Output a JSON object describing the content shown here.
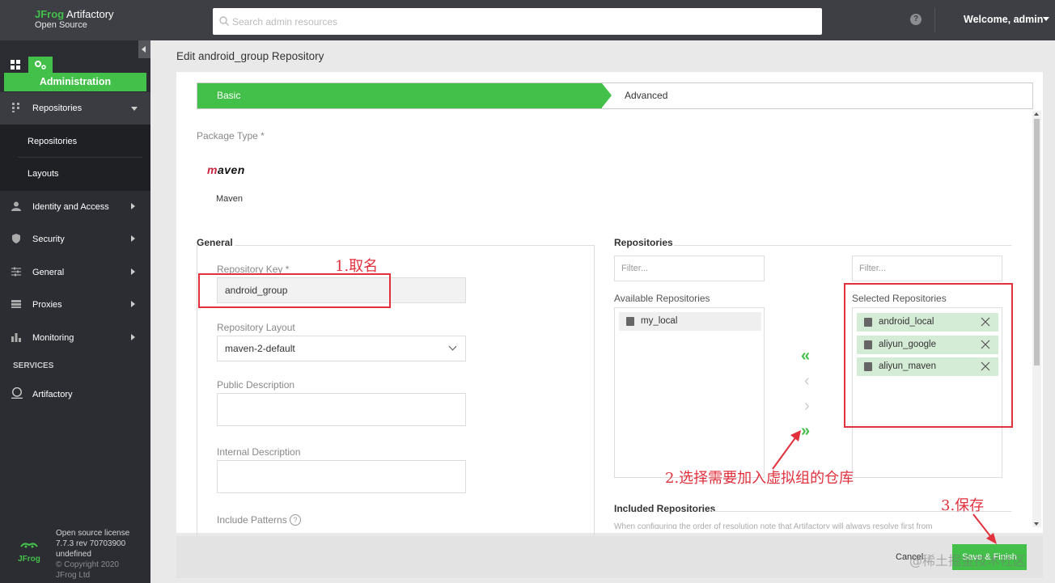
{
  "header": {
    "brand_accent": "JFrog",
    "brand_product": " Artifactory",
    "brand_edition": "Open Source",
    "search_placeholder": "Search admin resources",
    "help_symbol": "?",
    "welcome": "Welcome, admin"
  },
  "sidebar": {
    "admin_label": "Administration",
    "items": [
      {
        "label": "Repositories",
        "icon": "repositories-icon"
      },
      {
        "label": "Identity and Access",
        "icon": "user-icon"
      },
      {
        "label": "Security",
        "icon": "shield-icon"
      },
      {
        "label": "General",
        "icon": "sliders-icon"
      },
      {
        "label": "Proxies",
        "icon": "proxies-icon"
      },
      {
        "label": "Monitoring",
        "icon": "bar-chart-icon"
      }
    ],
    "sub_items": [
      "Repositories",
      "Layouts"
    ],
    "services_heading": "SERVICES",
    "service_item": "Artifactory",
    "footer": {
      "license": "Open source license",
      "version": "7.7.3 rev 70703900",
      "extra": "undefined",
      "copyright": "© Copyright 2020",
      "company": "JFrog Ltd",
      "logo_text": "JFrog"
    }
  },
  "page": {
    "title": "Edit android_group Repository",
    "steps": {
      "basic": "Basic",
      "advanced": "Advanced"
    },
    "package_type_label": "Package Type *",
    "package_logo": "maven",
    "package_name": "Maven",
    "general": {
      "title": "General",
      "repo_key_label": "Repository Key *",
      "repo_key_value": "android_group",
      "layout_label": "Repository Layout",
      "layout_value": "maven-2-default",
      "public_desc_label": "Public Description",
      "internal_desc_label": "Internal Description",
      "include_patterns_label": "Include Patterns",
      "help_symbol": "?"
    },
    "repositories": {
      "title": "Repositories",
      "filter_placeholder": "Filter...",
      "available_label": "Available Repositories",
      "available": [
        "my_local"
      ],
      "selected_label": "Selected Repositories",
      "selected": [
        "android_local",
        "aliyun_google",
        "aliyun_maven"
      ],
      "arrows": {
        "add_all": "«",
        "add": "‹",
        "remove": "›",
        "remove_all": "»"
      },
      "included_title": "Included Repositories",
      "included_hint": "When configuring the order of resolution note that Artifactory will always resolve first from"
    },
    "footer": {
      "cancel": "Cancel",
      "save": "Save & Finish"
    }
  },
  "annotations": {
    "step1": "1.取名",
    "step2": "2.选择需要加入虚拟组的仓库",
    "step3": "3.保存",
    "watermark": "@稀土掘金技术社区"
  },
  "colors": {
    "accent": "#43c04a",
    "annotation": "#e0313d",
    "topbar": "#3d3f45",
    "sidebar": "#2b2d33"
  }
}
